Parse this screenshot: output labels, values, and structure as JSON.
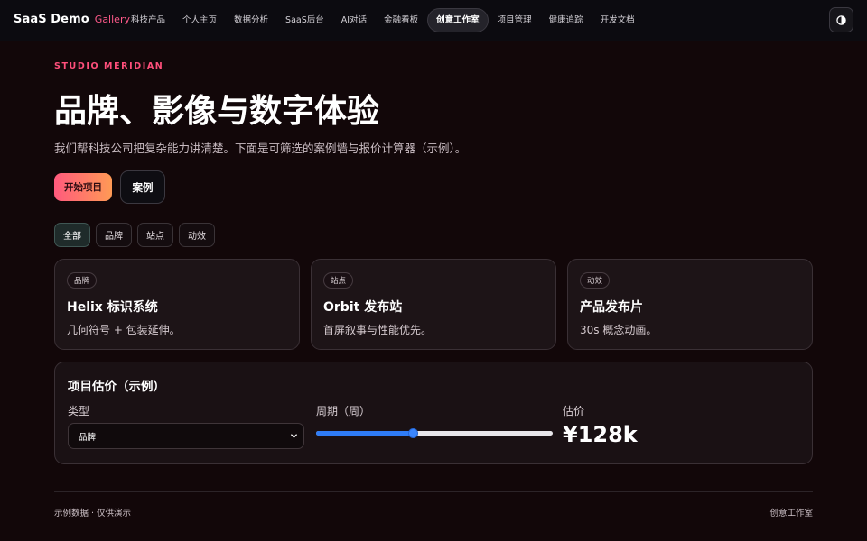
{
  "brand": {
    "name": "SaaS Demo",
    "tag": "Gallery"
  },
  "nav": {
    "items": [
      {
        "label": "科技产品"
      },
      {
        "label": "个人主页"
      },
      {
        "label": "数据分析"
      },
      {
        "label": "SaaS后台"
      },
      {
        "label": "AI对话"
      },
      {
        "label": "金融看板"
      },
      {
        "label": "创意工作室",
        "active": true
      },
      {
        "label": "项目管理"
      },
      {
        "label": "健康追踪"
      },
      {
        "label": "开发文档"
      }
    ],
    "theme_icon": "half-circle-contrast-icon"
  },
  "hero": {
    "eyebrow": "STUDIO MERIDIAN",
    "title": "品牌、影像与数字体验",
    "subtitle": "我们帮科技公司把复杂能力讲清楚。下面是可筛选的案例墙与报价计算器（示例）。",
    "primary_button": "开始项目",
    "secondary_button": "案例"
  },
  "filters": {
    "chips": [
      "全部",
      "品牌",
      "站点",
      "动效"
    ],
    "selected": "全部"
  },
  "cases": [
    {
      "tag": "品牌",
      "title": "Helix 标识系统",
      "desc": "几何符号 + 包装延伸。"
    },
    {
      "tag": "站点",
      "title": "Orbit 发布站",
      "desc": "首屏叙事与性能优先。"
    },
    {
      "tag": "动效",
      "title": "产品发布片",
      "desc": "30s 概念动画。"
    }
  ],
  "estimator": {
    "title": "项目估价（示例）",
    "type_label": "类型",
    "type_value": "品牌",
    "period_label": "周期（周）",
    "period_fraction": 0.41,
    "price_label": "估价",
    "price_value": "¥128k"
  },
  "footer": {
    "left": "示例数据 · 仅供演示",
    "right": "创意工作室"
  },
  "colors": {
    "accent": "#ff4f7b",
    "gradient_start": "#ff5a7d",
    "gradient_end": "#ff9a55",
    "slider": "#2f7cf6",
    "background": "#120709"
  }
}
